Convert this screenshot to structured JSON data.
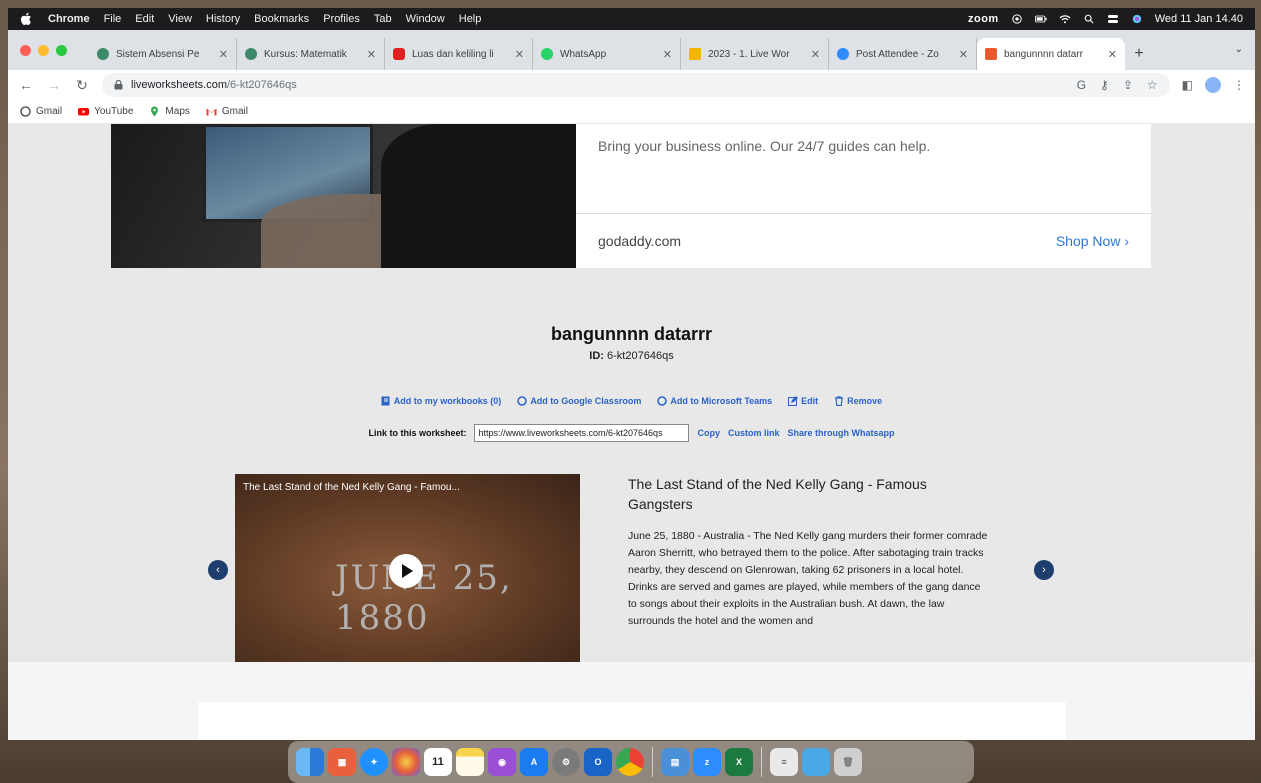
{
  "menubar": {
    "app": "Chrome",
    "items": [
      "File",
      "Edit",
      "View",
      "History",
      "Bookmarks",
      "Profiles",
      "Tab",
      "Window",
      "Help"
    ],
    "zoom": "zoom",
    "datetime": "Wed 11 Jan 14.40"
  },
  "tabs": [
    {
      "title": "Sistem Absensi Pe",
      "favicon_color": "#3c8a6a"
    },
    {
      "title": "Kursus: Matematik",
      "favicon_color": "#3c8a6a"
    },
    {
      "title": "Luas dan keliling li",
      "favicon_color": "#e02020"
    },
    {
      "title": "WhatsApp",
      "favicon_color": "#25d366"
    },
    {
      "title": "2023 - 1. Live Wor",
      "favicon_color": "#f4b400"
    },
    {
      "title": "Post Attendee - Zo",
      "favicon_color": "#2d8cff"
    },
    {
      "title": "bangunnnn datarr",
      "favicon_color": "#e85a2a",
      "active": true
    }
  ],
  "toolbar": {
    "url_host": "liveworksheets.com",
    "url_path": "/6-kt207646qs"
  },
  "bookmarks": [
    {
      "label": "Gmail",
      "icon": "gmail-icon"
    },
    {
      "label": "YouTube",
      "icon": "youtube-icon"
    },
    {
      "label": "Maps",
      "icon": "maps-icon"
    },
    {
      "label": "Gmail",
      "icon": "gmail-icon"
    }
  ],
  "ad": {
    "tagline": "Bring your business online. Our 24/7 guides can help.",
    "domain": "godaddy.com",
    "cta": "Shop Now ›"
  },
  "worksheet": {
    "title": "bangunnnn datarrr",
    "id_label": "ID:",
    "id_value": "6-kt207646qs",
    "actions": [
      {
        "label": "Add to my workbooks (0)",
        "icon": "workbook-icon"
      },
      {
        "label": "Add to Google Classroom",
        "icon": "google-classroom-icon"
      },
      {
        "label": "Add to Microsoft Teams",
        "icon": "microsoft-teams-icon"
      },
      {
        "label": "Edit",
        "icon": "edit-icon"
      },
      {
        "label": "Remove",
        "icon": "trash-icon"
      }
    ],
    "link_label": "Link to this worksheet:",
    "link_value": "https://www.liveworksheets.com/6-kt207646qs",
    "copy": "Copy",
    "custom_link": "Custom link",
    "share_whatsapp": "Share through Whatsapp"
  },
  "video": {
    "title": "The Last Stand of the Ned Kelly Gang - Famou...",
    "overlay_date": "JUNE 25, 1880"
  },
  "article": {
    "title": "The Last Stand of the Ned Kelly Gang - Famous Gangsters",
    "body": "June 25, 1880 - Australia - The Ned Kelly gang murders their former comrade Aaron Sherritt, who betrayed them to the police. After sabotaging train tracks nearby, they descend on Glenrowan, taking 62 prisoners in a local hotel. Drinks are served and games are played, while members of the gang dance to songs about their exploits in the Australian bush. At dawn, the law surrounds the hotel and the women and"
  },
  "dock": {
    "calendar_day": "11",
    "apps": [
      {
        "name": "finder-icon",
        "color": "#3a8de0"
      },
      {
        "name": "launchpad-icon",
        "color": "#e8603c"
      },
      {
        "name": "safari-icon",
        "color": "#1e90ff"
      },
      {
        "name": "photos-icon",
        "color": "#f0a030"
      },
      {
        "name": "calendar-icon",
        "color": "#f2f2f2"
      },
      {
        "name": "notes-icon",
        "color": "#f7d44c"
      },
      {
        "name": "podcasts-icon",
        "color": "#9b4fd6"
      },
      {
        "name": "app-store-icon",
        "color": "#1a7cf0"
      },
      {
        "name": "system-settings-icon",
        "color": "#7a7a7a"
      },
      {
        "name": "outlook-icon",
        "color": "#1a64c8"
      },
      {
        "name": "chrome-icon",
        "color": "#e8a020"
      },
      {
        "name": "preview-icon",
        "color": "#4a90d9"
      },
      {
        "name": "zoom-icon",
        "color": "#2d8cff"
      },
      {
        "name": "excel-icon",
        "color": "#1d7a3e"
      },
      {
        "name": "document-icon",
        "color": "#e9e9e9"
      },
      {
        "name": "folder-icon",
        "color": "#4aa8e8"
      },
      {
        "name": "trash-icon",
        "color": "#cfcfcf"
      }
    ]
  }
}
